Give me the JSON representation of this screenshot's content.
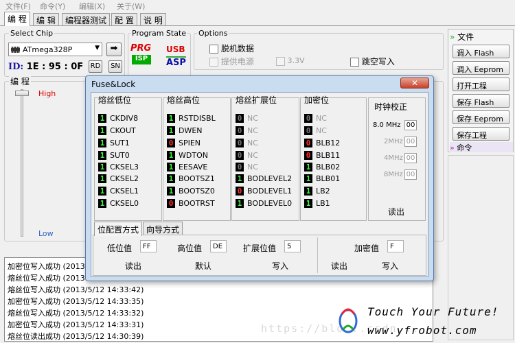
{
  "menu": [
    "文件(F)",
    "命令(Y)",
    "编辑(X)",
    "关于(W)"
  ],
  "tabs": [
    "编 程",
    "编 辑",
    "编程器测试",
    "配 置",
    "说 明"
  ],
  "select_chip": {
    "title": "Select Chip",
    "value": "ATmega328P"
  },
  "device_id": {
    "label": "ID:",
    "value": "1E : 95 : 0F",
    "rd": "RD",
    "sn": "SN"
  },
  "program_state": {
    "title": "Program State",
    "prg": "PRG",
    "isp": "ISP",
    "usb": "USB",
    "asp": "ASP"
  },
  "options": {
    "title": "Options",
    "offline": "脱机数据",
    "power": "提供电源",
    "voltage": "3.3V",
    "skip": "跳空写入"
  },
  "prog_panel": {
    "title": "编 程",
    "high": "High",
    "low": "Low"
  },
  "right_panel": {
    "file_header": "文件",
    "buttons": [
      "调入 Flash",
      "调入 Eeprom",
      "打开工程",
      "保存 Flash",
      "保存 Eeprom",
      "保存工程"
    ],
    "cmd_header": "命令"
  },
  "log": [
    "加密位写入成功 (2013",
    "熔丝位写入成功 (2013",
    "熔丝位写入成功 (2013/5/12 14:33:42)",
    "加密位写入成功 (2013/5/12 14:33:35)",
    "熔丝位写入成功 (2013/5/12 14:33:32)",
    "加密位写入成功 (2013/5/12 14:33:31)",
    "熔丝位读出成功 (2013/5/12 14:30:39)"
  ],
  "dialog": {
    "title": "Fuse&Lock",
    "close": "✕",
    "columns": [
      {
        "header": "熔丝低位",
        "bits": [
          {
            "v": "1",
            "name": "CKDIV8",
            "state": "one"
          },
          {
            "v": "1",
            "name": "CKOUT",
            "state": "one"
          },
          {
            "v": "1",
            "name": "SUT1",
            "state": "one"
          },
          {
            "v": "1",
            "name": "SUT0",
            "state": "one"
          },
          {
            "v": "1",
            "name": "CKSEL3",
            "state": "one"
          },
          {
            "v": "1",
            "name": "CKSEL2",
            "state": "one"
          },
          {
            "v": "1",
            "name": "CKSEL1",
            "state": "one"
          },
          {
            "v": "1",
            "name": "CKSEL0",
            "state": "one"
          }
        ]
      },
      {
        "header": "熔丝高位",
        "bits": [
          {
            "v": "1",
            "name": "RSTDISBL",
            "state": "one"
          },
          {
            "v": "1",
            "name": "DWEN",
            "state": "one"
          },
          {
            "v": "0",
            "name": "SPIEN",
            "state": "zero"
          },
          {
            "v": "1",
            "name": "WDTON",
            "state": "one"
          },
          {
            "v": "1",
            "name": "EESAVE",
            "state": "one"
          },
          {
            "v": "1",
            "name": "BOOTSZ1",
            "state": "one"
          },
          {
            "v": "1",
            "name": "BOOTSZ0",
            "state": "one"
          },
          {
            "v": "0",
            "name": "BOOTRST",
            "state": "zero"
          }
        ]
      },
      {
        "header": "熔丝扩展位",
        "bits": [
          {
            "v": "0",
            "name": "NC",
            "state": "off"
          },
          {
            "v": "0",
            "name": "NC",
            "state": "off"
          },
          {
            "v": "0",
            "name": "NC",
            "state": "off"
          },
          {
            "v": "0",
            "name": "NC",
            "state": "off"
          },
          {
            "v": "0",
            "name": "NC",
            "state": "off"
          },
          {
            "v": "1",
            "name": "BODLEVEL2",
            "state": "one"
          },
          {
            "v": "0",
            "name": "BODLEVEL1",
            "state": "zero"
          },
          {
            "v": "1",
            "name": "BODLEVEL0",
            "state": "one"
          }
        ]
      },
      {
        "header": "加密位",
        "bits": [
          {
            "v": "0",
            "name": "NC",
            "state": "off"
          },
          {
            "v": "0",
            "name": "NC",
            "state": "off"
          },
          {
            "v": "0",
            "name": "BLB12",
            "state": "zero"
          },
          {
            "v": "0",
            "name": "BLB11",
            "state": "zero"
          },
          {
            "v": "1",
            "name": "BLB02",
            "state": "one"
          },
          {
            "v": "1",
            "name": "BLB01",
            "state": "one"
          },
          {
            "v": "1",
            "name": "LB2",
            "state": "one"
          },
          {
            "v": "1",
            "name": "LB1",
            "state": "one"
          }
        ]
      }
    ],
    "clock": {
      "title": "时钟校正",
      "rows": [
        {
          "freq": "8.0 MHz",
          "val": "00",
          "enabled": true
        },
        {
          "freq": "2MHz",
          "val": "00",
          "enabled": false
        },
        {
          "freq": "4MHz",
          "val": "00",
          "enabled": false
        },
        {
          "freq": "8MHz",
          "val": "00",
          "enabled": false
        }
      ],
      "read": "读出"
    },
    "mode_tabs": [
      "位配置方式",
      "向导方式"
    ],
    "low_label": "低位值",
    "low_value": "FF",
    "high_label": "高位值",
    "high_value": "DE",
    "ext_label": "扩展位值",
    "ext_value": "5",
    "lock_label": "加密值",
    "lock_value": "F",
    "read_btn": "读出",
    "default_btn": "默认",
    "write_btn": "写入",
    "read_btn2": "读出",
    "write_btn2": "写入"
  },
  "watermark": "https://blo...csdn...",
  "brand_line1": "Touch Your Future!",
  "brand_line2": "www.yfrobot.com"
}
